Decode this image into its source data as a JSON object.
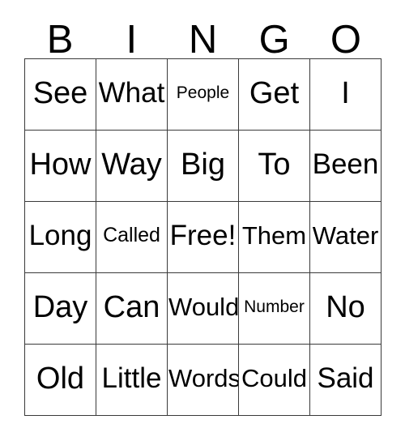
{
  "card": {
    "header_letters": [
      "B",
      "I",
      "N",
      "G",
      "O"
    ],
    "columns": 5,
    "rows": 5,
    "text_color": "#000000",
    "border_color": "#3a3a3a",
    "background_color": "#ffffff",
    "free_space_label": "Free!",
    "free_space_position": {
      "row": 3,
      "column": 3
    }
  },
  "grid": {
    "rows": [
      {
        "cells": [
          {
            "label": "See",
            "size": "xl"
          },
          {
            "label": "What",
            "size": "lg"
          },
          {
            "label": "People",
            "size": "xs"
          },
          {
            "label": "Get",
            "size": "xl"
          },
          {
            "label": "I",
            "size": "xl"
          }
        ]
      },
      {
        "cells": [
          {
            "label": "How",
            "size": "xl"
          },
          {
            "label": "Way",
            "size": "xl"
          },
          {
            "label": "Big",
            "size": "xl"
          },
          {
            "label": "To",
            "size": "xl"
          },
          {
            "label": "Been",
            "size": "lg"
          }
        ]
      },
      {
        "cells": [
          {
            "label": "Long",
            "size": "lg"
          },
          {
            "label": "Called",
            "size": "sm"
          },
          {
            "label": "Free!",
            "size": "lg"
          },
          {
            "label": "Them",
            "size": "md"
          },
          {
            "label": "Water",
            "size": "md"
          }
        ]
      },
      {
        "cells": [
          {
            "label": "Day",
            "size": "xl"
          },
          {
            "label": "Can",
            "size": "xl"
          },
          {
            "label": "Would",
            "size": "md"
          },
          {
            "label": "Number",
            "size": "xs"
          },
          {
            "label": "No",
            "size": "xl"
          }
        ]
      },
      {
        "cells": [
          {
            "label": "Old",
            "size": "xl"
          },
          {
            "label": "Little",
            "size": "lg"
          },
          {
            "label": "Words",
            "size": "md"
          },
          {
            "label": "Could",
            "size": "md"
          },
          {
            "label": "Said",
            "size": "lg"
          }
        ]
      }
    ]
  }
}
